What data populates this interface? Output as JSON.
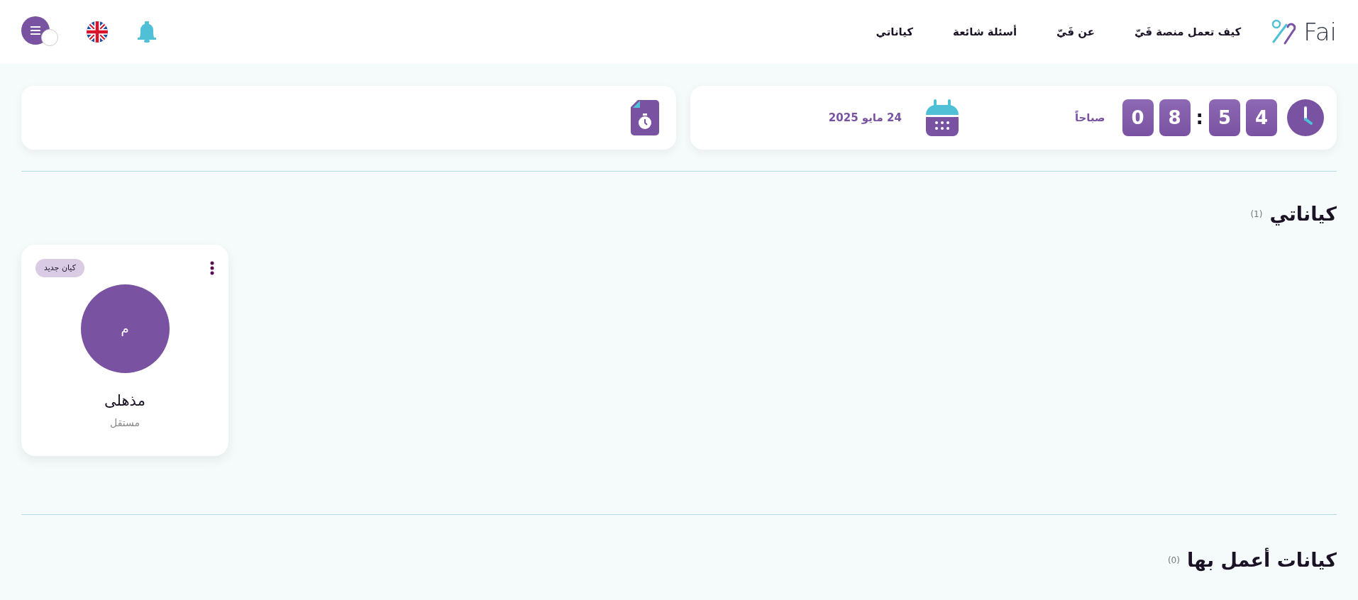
{
  "header": {
    "logo_text": "Fai",
    "nav": [
      {
        "label": "كيف تعمل منصة فَيّ"
      },
      {
        "label": "عن فَيّ"
      },
      {
        "label": "أسئلة شائعة"
      },
      {
        "label": "كياناتي"
      }
    ]
  },
  "clock_card": {
    "time": [
      {
        "kind": "digit",
        "text": "4"
      },
      {
        "kind": "digit",
        "text": "5"
      },
      {
        "kind": "separator",
        "text": ":"
      },
      {
        "kind": "digit",
        "text": "8"
      },
      {
        "kind": "digit",
        "text": "0"
      }
    ],
    "period": "صباحاً",
    "date": "24 مايو 2025"
  },
  "my_entities": {
    "title": "كياناتي",
    "count": "(1)",
    "cards": [
      {
        "badge": "كيان جديد",
        "initial": "م",
        "name": "مذهلى",
        "type": "مستقل"
      }
    ]
  },
  "work_entities": {
    "title": "كيانات أعمل بها",
    "count": "(0)"
  }
}
